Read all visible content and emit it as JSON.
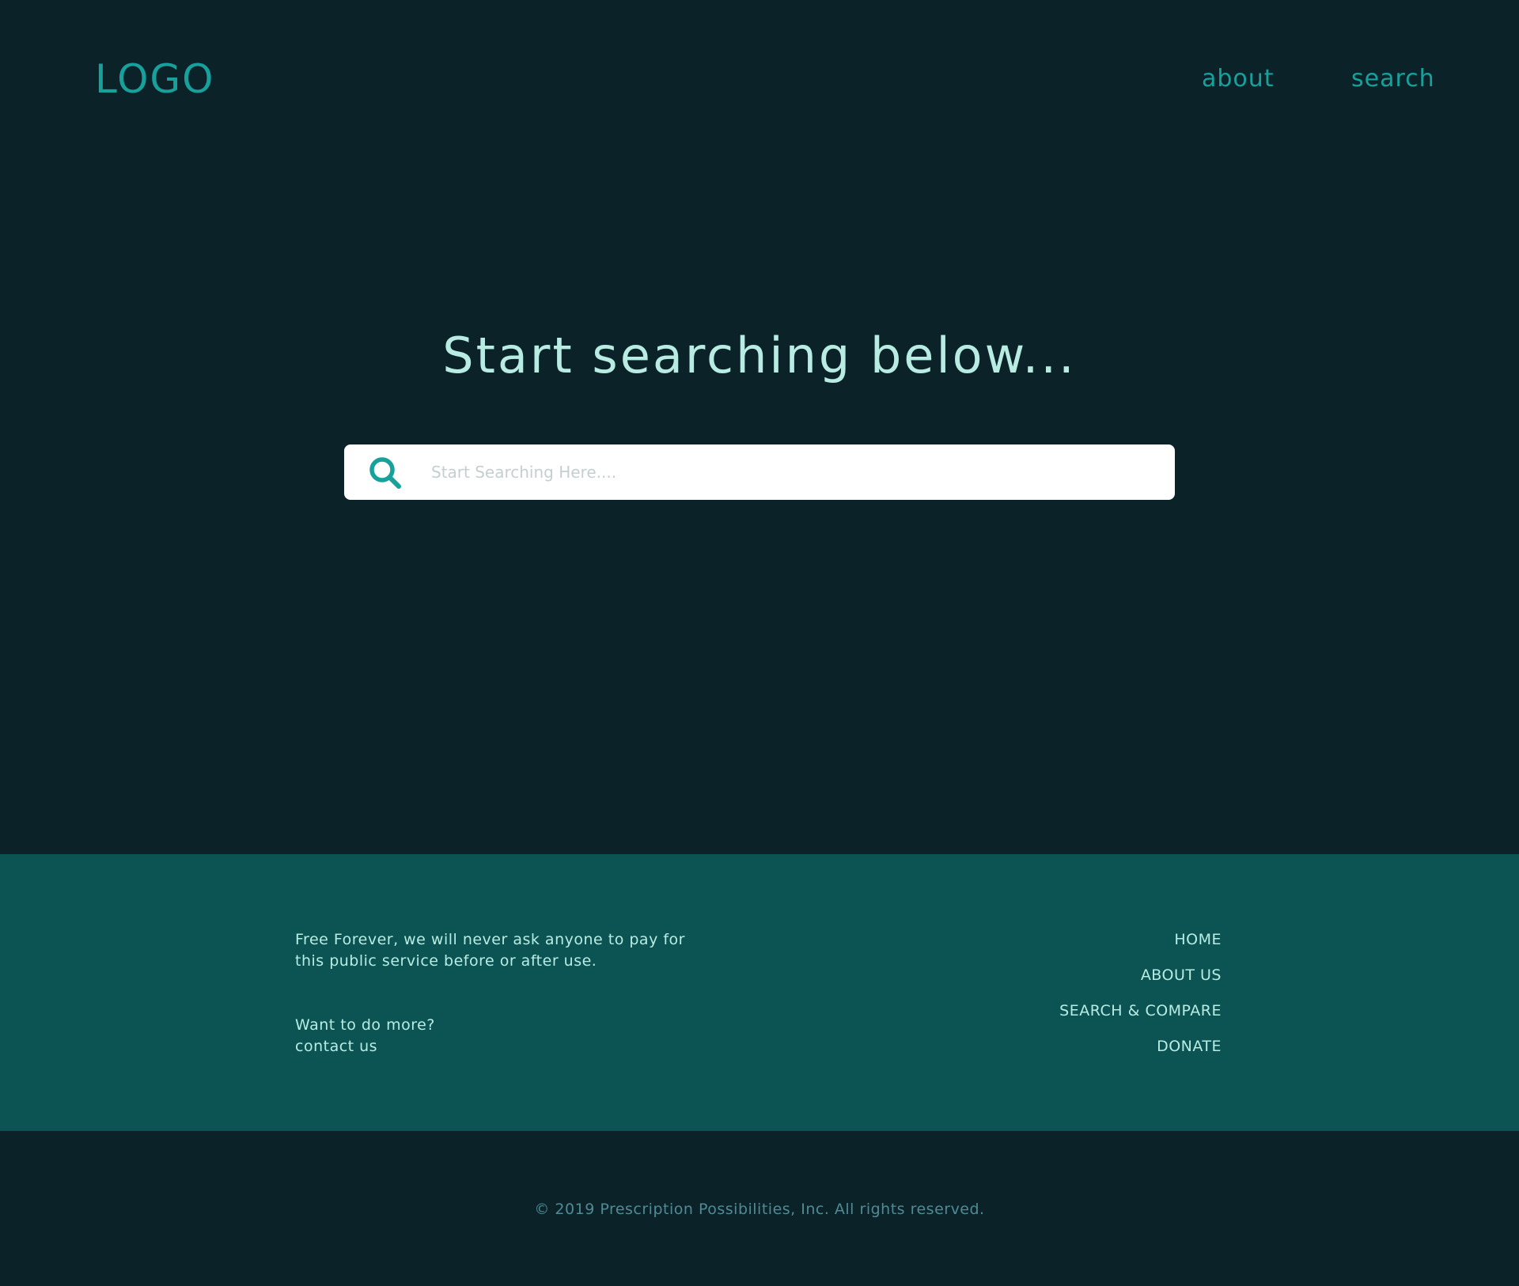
{
  "header": {
    "logo": "LOGO",
    "nav": {
      "about": "about",
      "search": "search"
    }
  },
  "hero": {
    "title": "Start searching below..."
  },
  "search": {
    "placeholder": "Start Searching Here....",
    "icon": "search-icon"
  },
  "footer": {
    "mission": "Free Forever, we will never ask anyone to pay for this public service before or after use.",
    "more_prompt": "Want to do more?",
    "contact_link": "contact us",
    "nav": [
      {
        "label": "HOME"
      },
      {
        "label": "ABOUT US"
      },
      {
        "label": "SEARCH & COMPARE"
      },
      {
        "label": "DONATE"
      }
    ],
    "copyright": "© 2019 Prescription Possibilities, Inc. All rights reserved."
  },
  "colors": {
    "background": "#0b2228",
    "accent": "#17a19c",
    "footer_band": "#0b5453",
    "light_text": "#b8ece3",
    "muted_text": "#4f8b95"
  }
}
